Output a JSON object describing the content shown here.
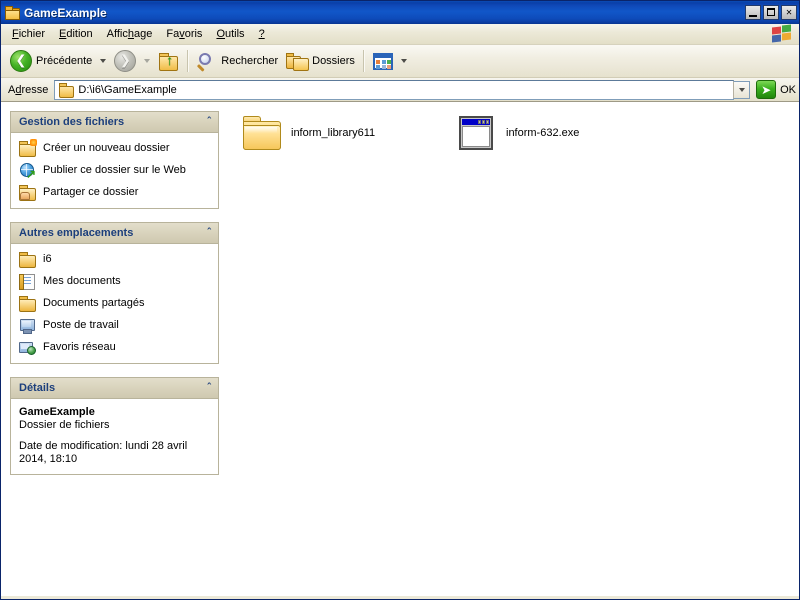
{
  "window": {
    "title": "GameExample",
    "icon": "folder-icon",
    "controls": {
      "minimize": "_",
      "maximize": "□",
      "close": "✕"
    }
  },
  "menu": {
    "items": [
      {
        "label": "Fichier",
        "accel_index": 0
      },
      {
        "label": "Edition",
        "accel_index": 0
      },
      {
        "label": "Affichage",
        "accel_index": 5
      },
      {
        "label": "Favoris",
        "accel_index": 3
      },
      {
        "label": "Outils",
        "accel_index": 0
      },
      {
        "label": "?",
        "accel_index": 0
      }
    ],
    "brand_icon": "windows-flag-icon"
  },
  "toolbar": {
    "back_label": "Précédente",
    "back_icon": "back-arrow-icon",
    "forward_icon": "forward-arrow-icon",
    "up_icon": "up-folder-icon",
    "search_label": "Rechercher",
    "search_icon": "search-icon",
    "folders_label": "Dossiers",
    "folders_icon": "folders-icon",
    "views_icon": "views-icon"
  },
  "address": {
    "label": "Adresse",
    "icon": "folder-icon",
    "value": "D:\\i6\\GameExample",
    "dropdown_icon": "chevron-down-icon",
    "go_label": "OK",
    "go_icon": "go-arrow-icon"
  },
  "sidebar": {
    "panels": [
      {
        "title": "Gestion des fichiers",
        "collapse_icon": "chevron-up-icon",
        "tasks": [
          {
            "label": "Créer un nouveau dossier",
            "icon": "new-folder-icon"
          },
          {
            "label": "Publier ce dossier sur le Web",
            "icon": "publish-web-icon"
          },
          {
            "label": "Partager ce dossier",
            "icon": "share-folder-icon"
          }
        ]
      },
      {
        "title": "Autres emplacements",
        "collapse_icon": "chevron-up-icon",
        "tasks": [
          {
            "label": "i6",
            "icon": "folder-icon"
          },
          {
            "label": "Mes documents",
            "icon": "my-documents-icon"
          },
          {
            "label": "Documents partagés",
            "icon": "folder-icon"
          },
          {
            "label": "Poste de travail",
            "icon": "my-computer-icon"
          },
          {
            "label": "Favoris réseau",
            "icon": "network-places-icon"
          }
        ]
      },
      {
        "title": "Détails",
        "collapse_icon": "chevron-up-icon",
        "details": {
          "name": "GameExample",
          "type": "Dossier de fichiers",
          "date": "Date de modification: lundi 28 avril 2014, 18:10"
        }
      }
    ]
  },
  "files": [
    {
      "name": "inform_library611",
      "icon": "folder-icon",
      "kind": "folder"
    },
    {
      "name": "inform-632.exe",
      "icon": "application-icon",
      "kind": "exe"
    }
  ],
  "colors": {
    "titlebar": "#0f49b8",
    "panel_header": "#d8d2bb",
    "panel_title_text": "#1c3f7c",
    "chrome": "#ece9d8",
    "go_green": "#3ab01d"
  }
}
